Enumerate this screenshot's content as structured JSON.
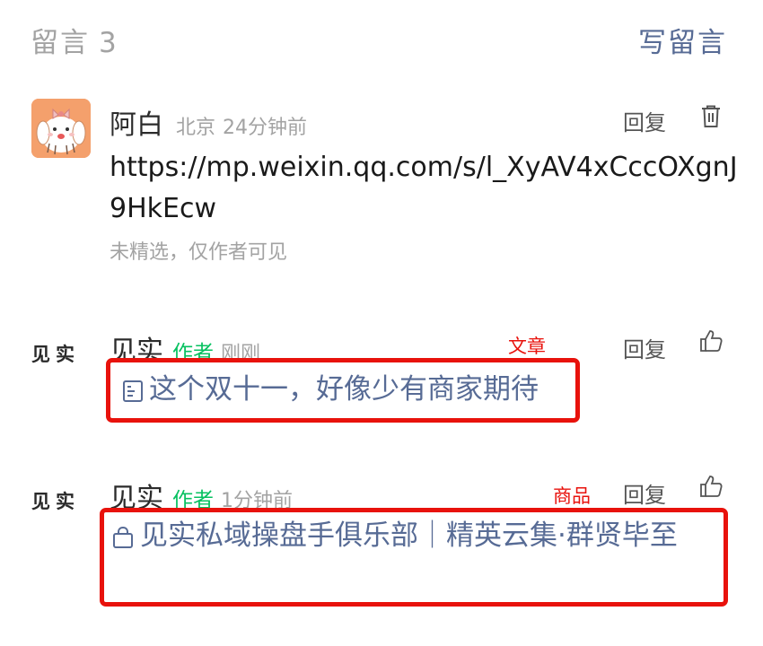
{
  "header": {
    "title": "留言",
    "count": "3",
    "write_label": "写留言"
  },
  "comments": [
    {
      "nickname": "阿白",
      "location": "北京",
      "time": "24分钟前",
      "reply_label": "回复",
      "action_icon": "trash-icon",
      "body": "https://mp.weixin.qq.com/s/l_XyAV4xCccOXgnJ9HkEcw",
      "note": "未精选，仅作者可见",
      "avatar": "cartoon-dog-avatar"
    },
    {
      "nickname": "见实",
      "author_tag": "作者",
      "time": "刚刚",
      "reply_label": "回复",
      "action_icon": "thumbs-up-icon",
      "avatar_text": "见实",
      "annotation": "文章",
      "link_icon": "article-icon",
      "link_text": "这个双十一，好像少有商家期待"
    },
    {
      "nickname": "见实",
      "author_tag": "作者",
      "time": "1分钟前",
      "reply_label": "回复",
      "action_icon": "thumbs-up-icon",
      "avatar_text": "见实",
      "annotation": "商品",
      "link_icon": "shopping-bag-icon",
      "link_text": "见实私域操盘手俱乐部｜精英云集·群贤毕至"
    }
  ],
  "colors": {
    "link": "#576b95",
    "author_tag": "#07c160",
    "annotation_red": "#e8120c",
    "muted": "#a3a3a3"
  }
}
